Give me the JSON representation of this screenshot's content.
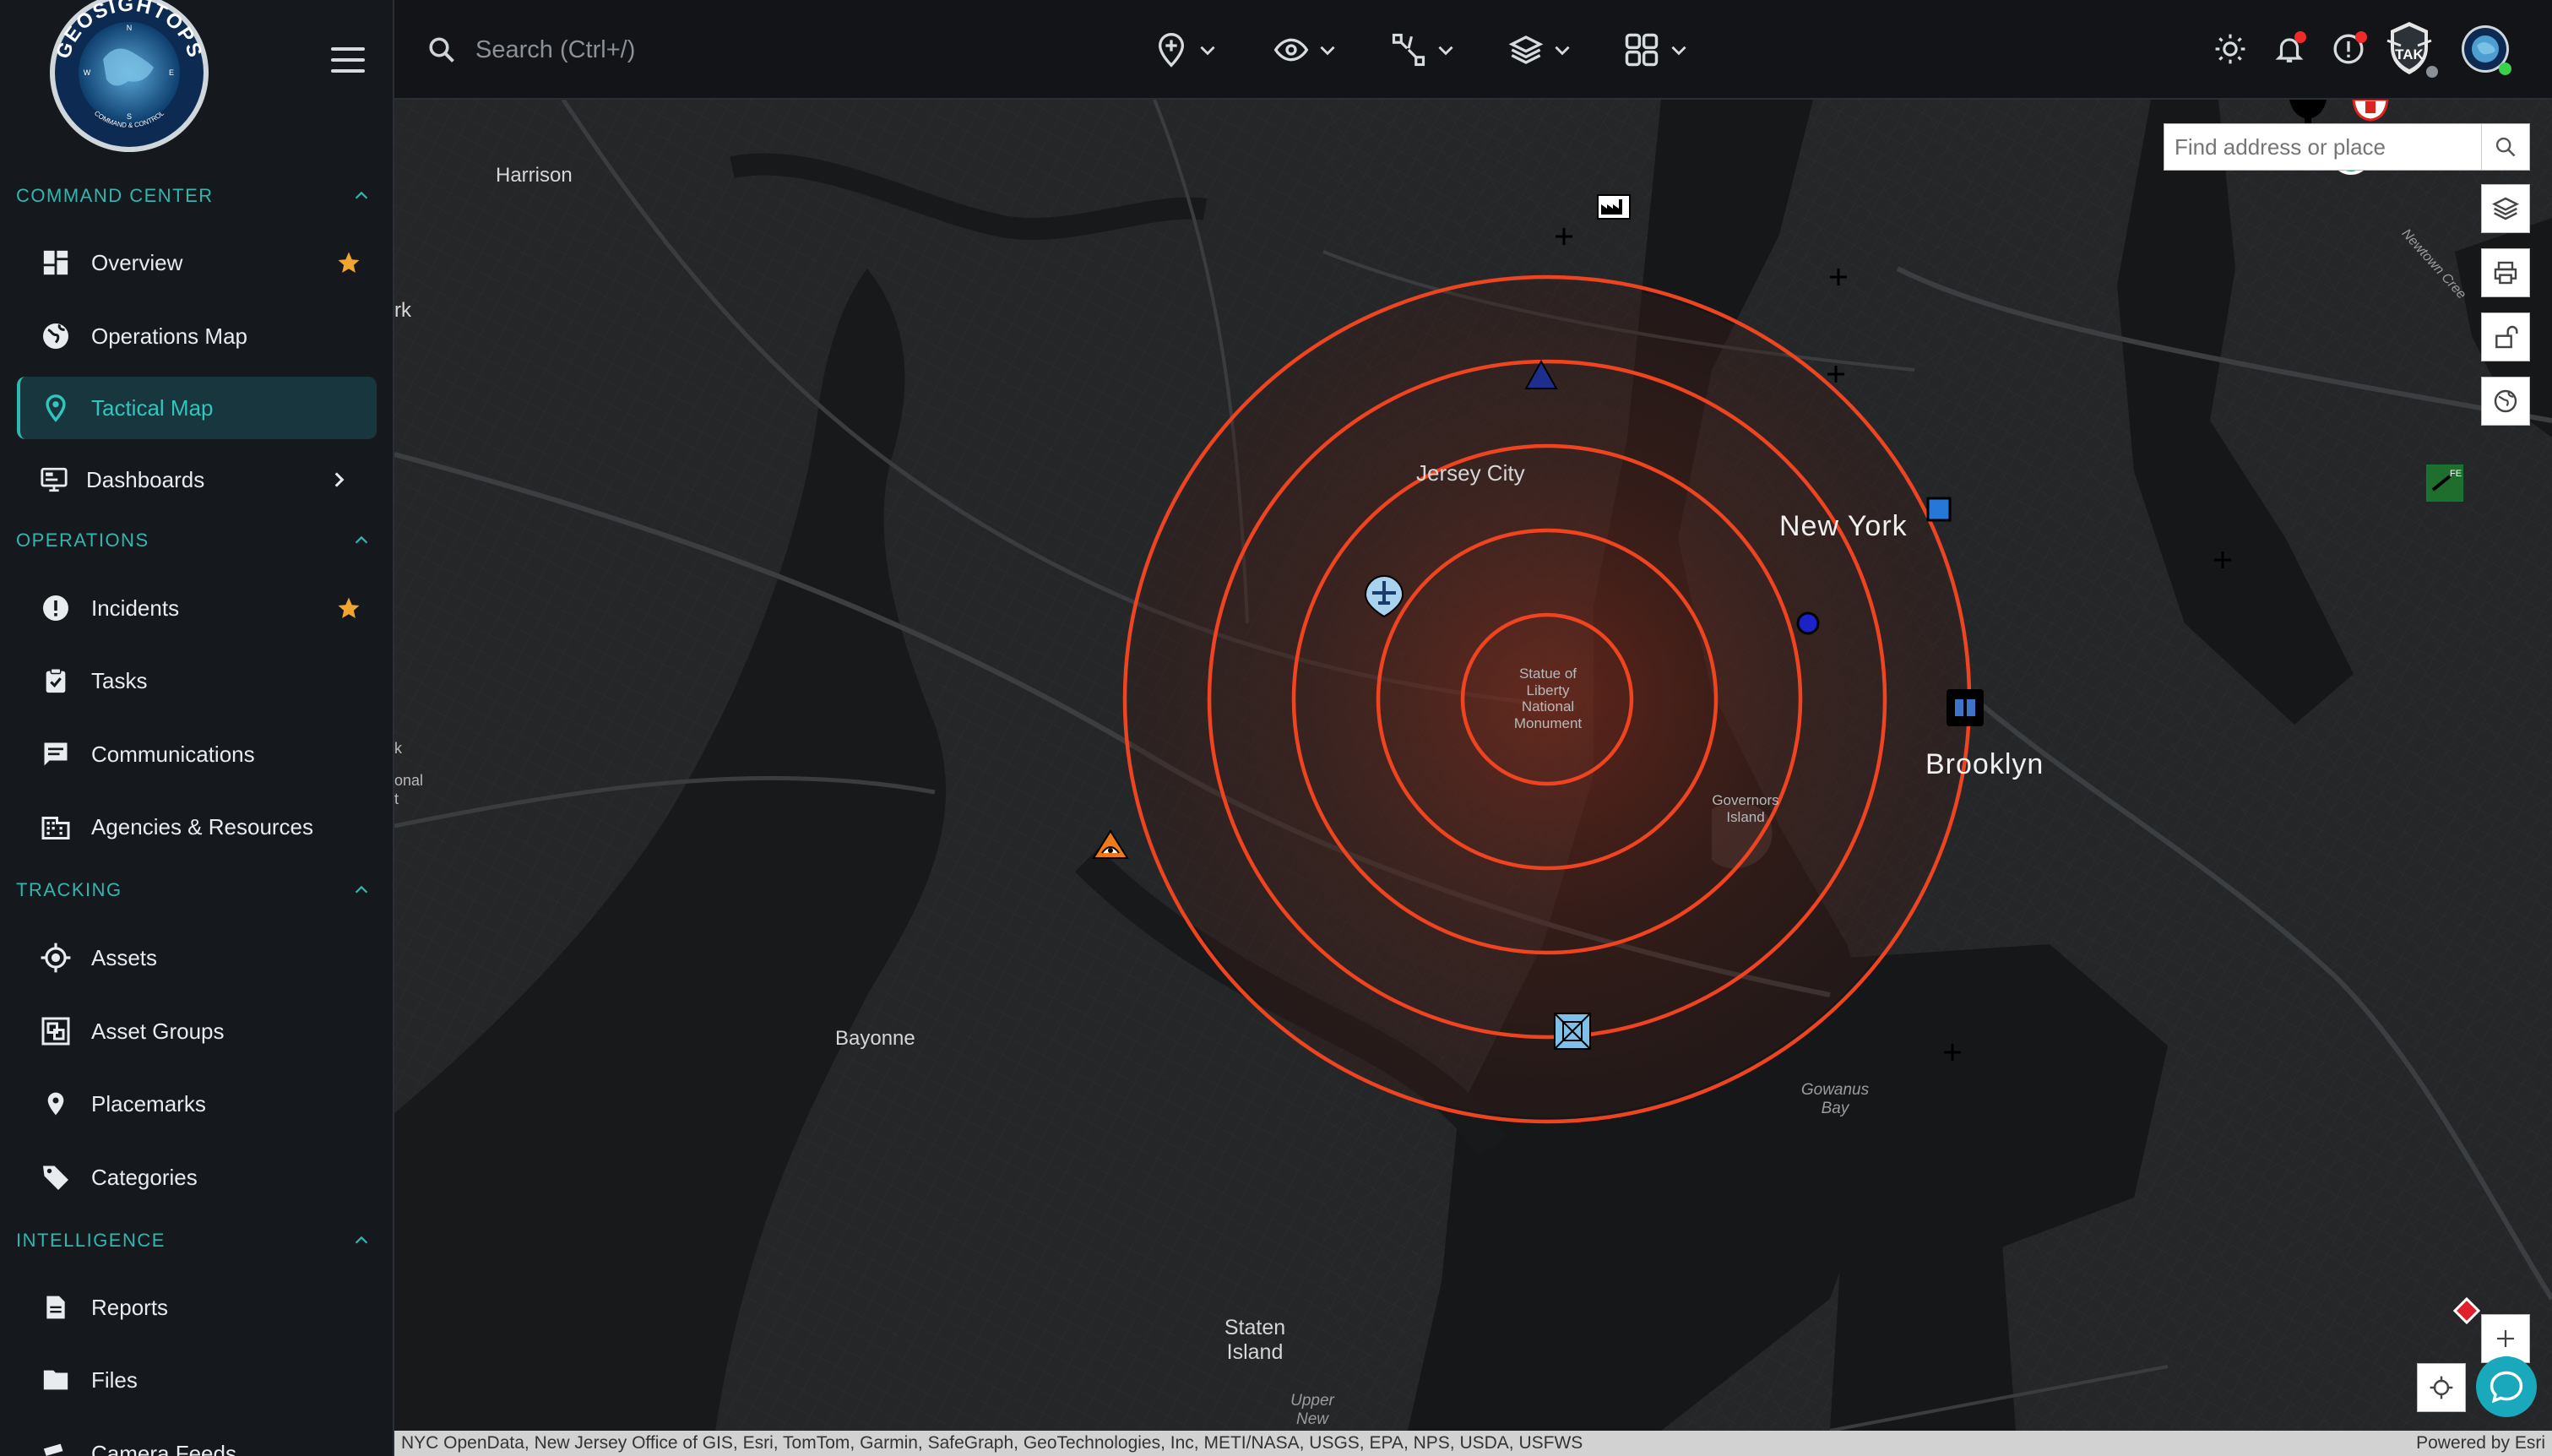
{
  "logo": {
    "arc_text": "GEOSIGHTOPS",
    "bottom_text": "COMMAND & CONTROL",
    "compass": [
      "N",
      "E",
      "S",
      "W"
    ]
  },
  "sidebar": {
    "sections": [
      {
        "title": "COMMAND CENTER",
        "items": [
          {
            "label": "Overview",
            "icon": "dashboard-icon",
            "starred": true
          },
          {
            "label": "Operations Map",
            "icon": "globe-icon"
          },
          {
            "label": "Tactical Map",
            "icon": "map-pin-icon",
            "active": true
          },
          {
            "label": "Dashboards",
            "icon": "monitor-icon",
            "has_submenu": true
          }
        ]
      },
      {
        "title": "OPERATIONS",
        "items": [
          {
            "label": "Incidents",
            "icon": "alert-circle-icon",
            "starred": true
          },
          {
            "label": "Tasks",
            "icon": "clipboard-check-icon"
          },
          {
            "label": "Communications",
            "icon": "message-icon"
          },
          {
            "label": "Agencies & Resources",
            "icon": "building-icon"
          }
        ]
      },
      {
        "title": "TRACKING",
        "items": [
          {
            "label": "Assets",
            "icon": "crosshair-icon"
          },
          {
            "label": "Asset Groups",
            "icon": "group-icon"
          },
          {
            "label": "Placemarks",
            "icon": "map-marker-icon"
          },
          {
            "label": "Categories",
            "icon": "tag-icon"
          }
        ]
      },
      {
        "title": "INTELLIGENCE",
        "items": [
          {
            "label": "Reports",
            "icon": "document-icon"
          },
          {
            "label": "Files",
            "icon": "folder-icon"
          },
          {
            "label": "Camera Feeds",
            "icon": "camera-icon"
          }
        ]
      }
    ]
  },
  "topbar": {
    "search_placeholder": "Search (Ctrl+/)",
    "tak_label": "TAK"
  },
  "map": {
    "find_placeholder": "Find address or place",
    "labels": {
      "harrison": "Harrison",
      "newark_fragment": "rk",
      "jersey_city": "Jersey City",
      "new_york": "New York",
      "brooklyn": "Brooklyn",
      "bayonne": "Bayonne",
      "staten_island": "Staten Island",
      "upper_new": "Upper New",
      "statue": "Statue of Liberty National Monument",
      "governors": "Governors Island",
      "gowanus": "Gowanus Bay",
      "newtown": "Newtown Cree",
      "fragment_k": "k",
      "fragment_onal": "onal",
      "fragment_t": "t"
    },
    "icon_text": {
      "fe": "FE"
    },
    "attribution": "NYC OpenData, New Jersey Office of GIS, Esri, TomTom, Garmin, SafeGraph, GeoTechnologies, Inc, METI/NASA, USGS, EPA, NPS, USDA, USFWS",
    "powered_by": "Powered by Esri"
  },
  "colors": {
    "accent": "#2fb8b0",
    "ring": "#f0431f",
    "star": "#f0a532",
    "alert": "#f02a2a"
  }
}
